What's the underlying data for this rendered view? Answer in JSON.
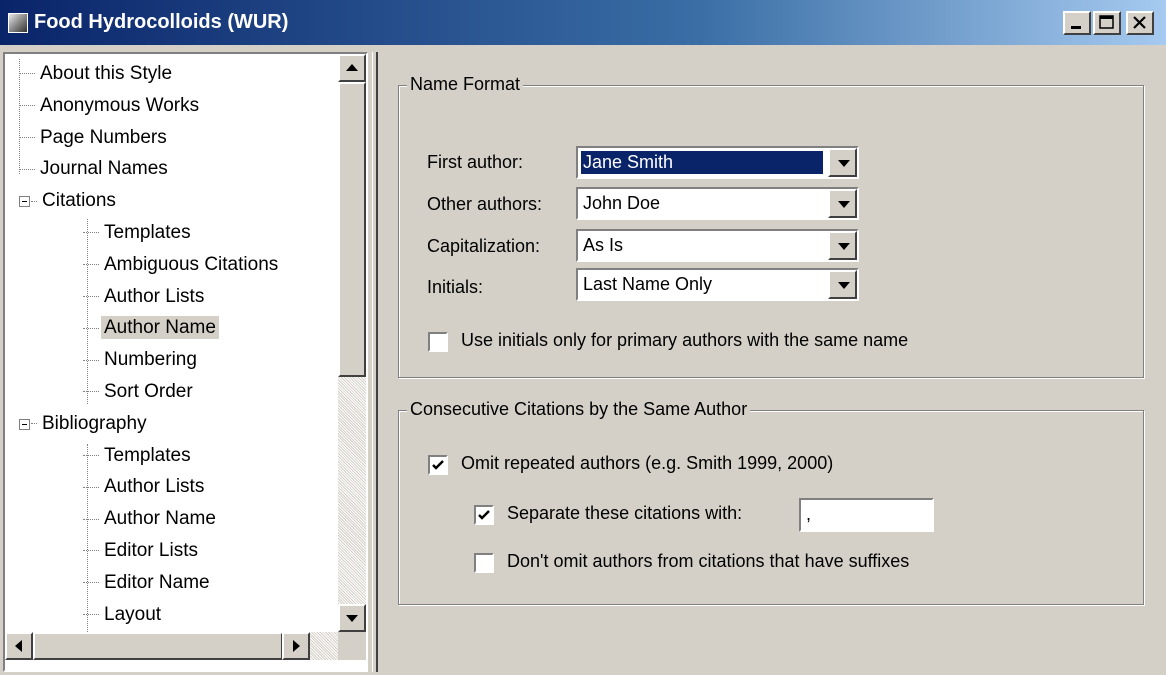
{
  "window": {
    "title": "Food Hydrocolloids (WUR)",
    "app_icon": "endnote-style-icon",
    "controls": [
      "minimize-icon",
      "maximize-icon",
      "close-icon"
    ]
  },
  "tree": {
    "items": [
      {
        "label": "About this Style",
        "level": 0,
        "expander": false
      },
      {
        "label": "Anonymous Works",
        "level": 0,
        "expander": false
      },
      {
        "label": "Page Numbers",
        "level": 0,
        "expander": false
      },
      {
        "label": "Journal Names",
        "level": 0,
        "expander": false
      },
      {
        "label": "Citations",
        "level": 0,
        "expander": true,
        "expanded": true
      },
      {
        "label": "Templates",
        "level": 1,
        "expander": false
      },
      {
        "label": "Ambiguous Citations",
        "level": 1,
        "expander": false
      },
      {
        "label": "Author Lists",
        "level": 1,
        "expander": false
      },
      {
        "label": "Author Name",
        "level": 1,
        "expander": false,
        "selected": true
      },
      {
        "label": "Numbering",
        "level": 1,
        "expander": false
      },
      {
        "label": "Sort Order",
        "level": 1,
        "expander": false
      },
      {
        "label": "Bibliography",
        "level": 0,
        "expander": true,
        "expanded": true
      },
      {
        "label": "Templates",
        "level": 1,
        "expander": false
      },
      {
        "label": "Author Lists",
        "level": 1,
        "expander": false
      },
      {
        "label": "Author Name",
        "level": 1,
        "expander": false
      },
      {
        "label": "Editor Lists",
        "level": 1,
        "expander": false
      },
      {
        "label": "Editor Name",
        "level": 1,
        "expander": false
      },
      {
        "label": "Layout",
        "level": 1,
        "expander": false
      }
    ]
  },
  "name_format": {
    "legend": "Name Format",
    "first_author": {
      "label": "First author:",
      "value": "Jane Smith"
    },
    "other_authors": {
      "label": "Other authors:",
      "value": "John Doe"
    },
    "capitalization": {
      "label": "Capitalization:",
      "value": "As Is"
    },
    "initials": {
      "label": "Initials:",
      "value": "Last Name Only"
    },
    "use_initials_checkbox": {
      "label": "Use initials only for primary authors with the same name",
      "checked": false
    }
  },
  "consecutive": {
    "legend": "Consecutive Citations by the Same Author",
    "omit_repeated": {
      "label": "Omit repeated authors (e.g. Smith 1999, 2000)",
      "checked": true
    },
    "separate_with": {
      "label": "Separate these citations with:",
      "checked": true,
      "value": ","
    },
    "dont_omit_suffixes": {
      "label": "Don't omit authors from citations that have suffixes",
      "checked": false
    }
  },
  "colors": {
    "title_bar_start": "#0a246a",
    "title_bar_end": "#a6caf0",
    "selection": "#0a246a",
    "face": "#d4d0c8"
  }
}
